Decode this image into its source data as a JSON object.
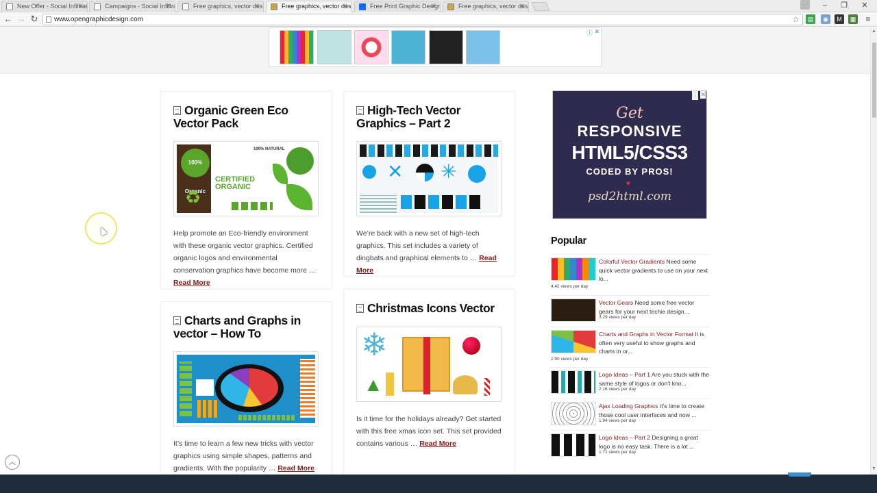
{
  "browser": {
    "tabs": [
      {
        "label": "New Offer - Social Infiltrat",
        "active": false
      },
      {
        "label": "Campaigns - Social Infiltra",
        "active": false
      },
      {
        "label": "Free graphics, vector desig",
        "active": false
      },
      {
        "label": "Free graphics, vector desig",
        "active": true
      },
      {
        "label": "Free Print Graphic Design",
        "active": false
      },
      {
        "label": "Free graphics, vector desig",
        "active": false
      }
    ],
    "url": "www.opengraphicdesign.com",
    "window_controls": {
      "minimize": "–",
      "restore": "❐",
      "close": "✕"
    },
    "extensions": [
      "ext-green-icon",
      "ext-camera-icon",
      "ext-m-icon",
      "ext-grid-icon",
      "menu-icon"
    ]
  },
  "posts": [
    {
      "title": "Organic Green Eco Vector Pack",
      "excerpt": "Help promote an Eco-friendly environment with these organic vector graphics. Certified organic logos and environmental conservation graphics have become more …",
      "read_more": "Read More",
      "image_texts": {
        "badge": "100% Organic",
        "certified": "CERTIFIED ORGANIC",
        "natural": "100% NATURAL"
      }
    },
    {
      "title": "High-Tech Vector Graphics – Part 2",
      "excerpt": "We’re back with a new set of high-tech graphics. This set includes a variety of dingbats and graphical elements to …",
      "read_more": "Read More"
    },
    {
      "title": "Charts and Graphs in vector – How To",
      "excerpt": "It’s time to learn a few new tricks with vector graphics using simple shapes, patterns and gradients. With the popularity …",
      "read_more": "Read More"
    },
    {
      "title": "Christmas Icons Vector",
      "excerpt": "Is it time for the holidays already? Get started with this free xmas icon set. This set provided contains various …",
      "read_more": "Read More"
    }
  ],
  "sidebar_ad": {
    "line1": "Get",
    "line2": "RESPONSIVE",
    "line3": "HTML5/CSS3",
    "line4": "CODED BY PROS!",
    "line5": "psd2html.com"
  },
  "popular": {
    "heading": "Popular",
    "items": [
      {
        "title": "Colorful Vector Gradients",
        "text": " Need some quick vector gradients to use on your next lo...",
        "views": "4.42 views per day"
      },
      {
        "title": "Vector Gears",
        "text": " Need some free vector gears for your next techie design...",
        "views": "3.29 views per day"
      },
      {
        "title": "Charts and Graphs in Vector Format",
        "text": " It is often very useful to show graphs and charts in or...",
        "views": "2.90 views per day"
      },
      {
        "title": "Logo Ideas – Part 1",
        "text": " Are you stuck with the same style of logos or don't kno...",
        "views": "2.16 views per day"
      },
      {
        "title": "Ajax Loading Graphics",
        "text": " It's time to create those cool user interfaces and now ...",
        "views": "1.94 views per day"
      },
      {
        "title": "Logo Ideas – Part 2",
        "text": " Designing a great logo is no easy task. There is a lot ...",
        "views": "1.71 views per day"
      }
    ]
  },
  "colors": {
    "link": "#8b1a1a",
    "footer": "#1d2b3a",
    "ad_bg": "#2e2b4e"
  }
}
